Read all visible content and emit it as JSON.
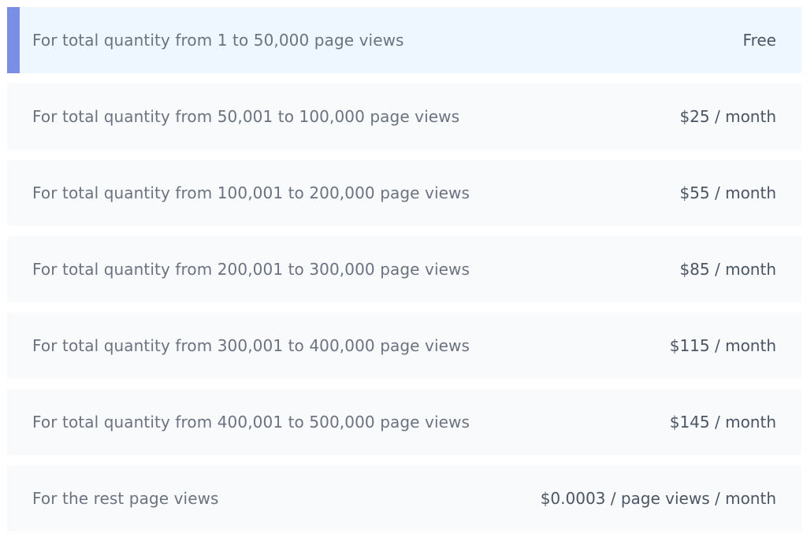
{
  "colors": {
    "row_background": "#f9fafb",
    "active_row_background": "#eef6ff",
    "accent": "#7b8ee6",
    "description_text": "#6b7280",
    "price_text": "#4b5563"
  },
  "pricing_tiers": [
    {
      "description": "For total quantity from 1 to 50,000 page views",
      "price": "Free",
      "active": true
    },
    {
      "description": "For total quantity from 50,001 to 100,000 page views",
      "price": "$25 / month",
      "active": false
    },
    {
      "description": "For total quantity from 100,001 to 200,000 page views",
      "price": "$55 / month",
      "active": false
    },
    {
      "description": "For total quantity from 200,001 to 300,000 page views",
      "price": "$85 / month",
      "active": false
    },
    {
      "description": "For total quantity from 300,001 to 400,000 page views",
      "price": "$115 / month",
      "active": false
    },
    {
      "description": "For total quantity from 400,001 to 500,000 page views",
      "price": "$145 / month",
      "active": false
    },
    {
      "description": "For the rest page views",
      "price": "$0.0003 / page views / month",
      "active": false
    }
  ]
}
